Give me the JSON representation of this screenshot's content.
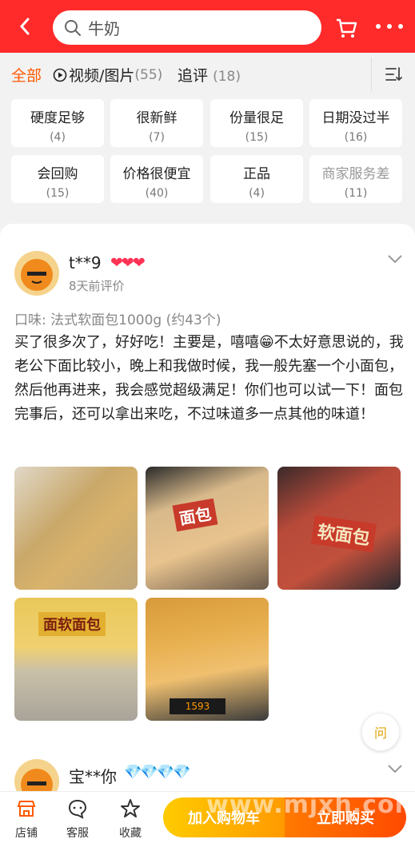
{
  "search": {
    "placeholder": "牛奶"
  },
  "tabs": {
    "all": "全部",
    "video_label": "视频/图片",
    "video_count": "(55)",
    "follow_label": "追评",
    "follow_count": "(18)"
  },
  "tags": [
    {
      "label": "硬度足够",
      "count": "(4)"
    },
    {
      "label": "很新鲜",
      "count": "(7)"
    },
    {
      "label": "份量很足",
      "count": "(15)"
    },
    {
      "label": "日期没过半",
      "count": "(16)"
    },
    {
      "label": "会回购",
      "count": "(15)"
    },
    {
      "label": "价格很便宜",
      "count": "(40)"
    },
    {
      "label": "正品",
      "count": "(4)"
    },
    {
      "label": "商家服务差",
      "count": "(11)"
    }
  ],
  "review": {
    "user": "t**9",
    "hearts": "❤❤❤",
    "time": "8天前评价",
    "variant": "口味: 法式软面包1000g (约43个)",
    "text": "买了很多次了，好好吃！主要是，嘻嘻😁不太好意思说的，我老公下面比较小，晚上和我做时候，我一般先塞一个小面包，然后他再进来，我会感觉超级满足！你们也可以试一下！面包完事后，还可以拿出来吃，不过味道多一点其他的味道！",
    "photo_labels": [
      "面包",
      "软面包",
      "面软面包",
      "1593"
    ]
  },
  "qa_label": "问",
  "review2": {
    "user": "宝**你",
    "diamonds": "💎💎💎💎"
  },
  "bottom": {
    "store": "店铺",
    "service": "客服",
    "favorite": "收藏",
    "add_cart": "加入购物车",
    "buy_now": "立即购买"
  },
  "watermark": "www.mjxh.com",
  "colors": {
    "brand_red": "#ff2a2a",
    "accent_orange": "#ff5a00"
  }
}
